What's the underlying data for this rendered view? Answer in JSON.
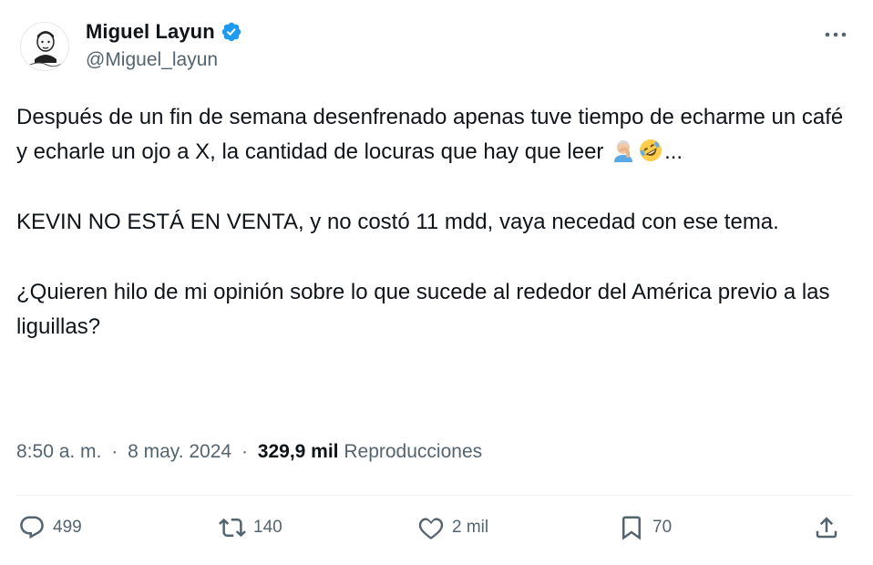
{
  "author": {
    "display_name": "Miguel Layun",
    "handle": "@Miguel_layun",
    "verified_icon": "verified-badge-icon",
    "accent_color": "#1d9bf0"
  },
  "tweet": {
    "paragraph_1_a": "Después de un fin de semana desenfrenado apenas tuve tiempo de echarme un café y echarle un ojo a X, la cantidad de locuras que hay que leer ",
    "paragraph_1_b": "...",
    "paragraph_2": "KEVIN NO ESTÁ EN VENTA, y no costó 11 mdd, vaya necedad con ese tema.",
    "paragraph_3": "¿Quieren hilo de mi opinión sobre lo que sucede al rededor del América previo a las liguillas?",
    "emojis": [
      "man-facepalming-emoji",
      "rolling-on-floor-laughing-emoji"
    ]
  },
  "meta": {
    "time": "8:50 a. m.",
    "separator": "·",
    "date": "8 may. 2024",
    "views_count": "329,9 mil",
    "views_label": "Reproducciones"
  },
  "actions": {
    "replies": "499",
    "reposts": "140",
    "likes": "2 mil",
    "bookmarks": "70",
    "icon_color": "#536471"
  }
}
